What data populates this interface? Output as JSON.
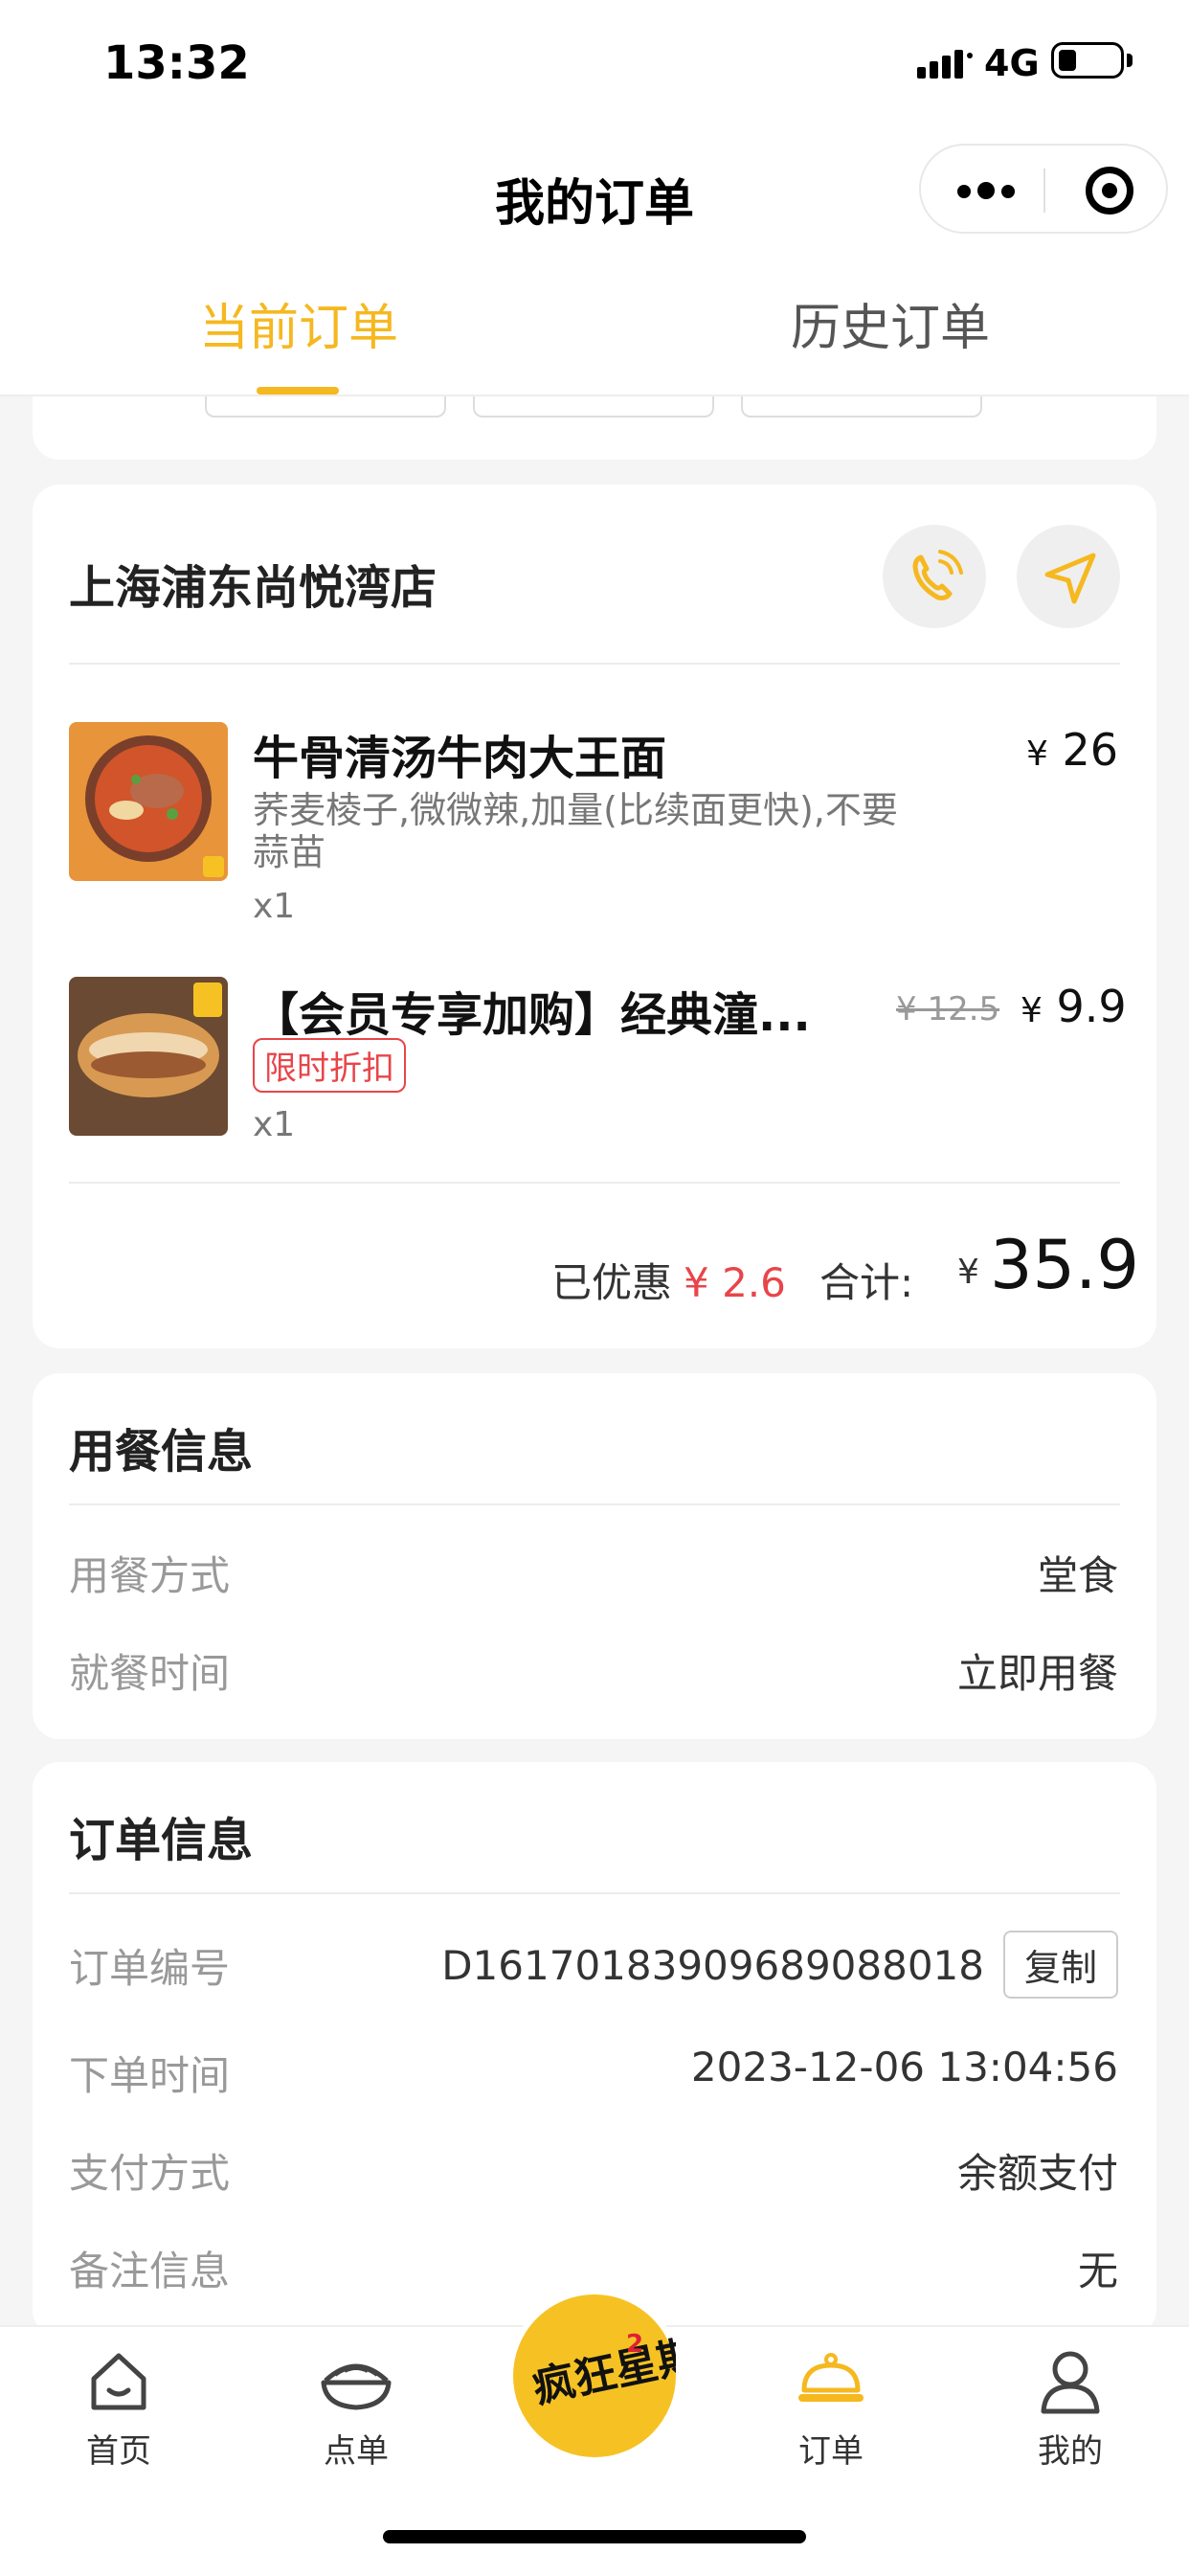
{
  "status_bar": {
    "time": "13:32",
    "network": "4G"
  },
  "nav": {
    "title": "我的订单"
  },
  "tabs": [
    {
      "label": "当前订单",
      "active": true
    },
    {
      "label": "历史订单",
      "active": false
    }
  ],
  "store": {
    "name": "上海浦东尚悦湾店",
    "items": [
      {
        "name": "牛骨清汤牛肉大王面",
        "spec_line1": "荞麦棱子,微微辣,加量(比续面更快),不要",
        "spec_line2": "蒜苗",
        "qty": "x1",
        "currency": "¥",
        "price": "26"
      },
      {
        "name": "【会员专享加购】经典潼...",
        "tag": "限时折扣",
        "qty": "x1",
        "currency": "¥",
        "original_price": "¥ 12.5",
        "price": "9.9"
      }
    ],
    "discount_label": "已优惠",
    "discount_value": "¥ 2.6",
    "total_label": "合计:",
    "total_currency": "¥",
    "total_value": "35.9"
  },
  "dining_info": {
    "title": "用餐信息",
    "rows": [
      {
        "label": "用餐方式",
        "value": "堂食"
      },
      {
        "label": "就餐时间",
        "value": "立即用餐"
      }
    ]
  },
  "order_info": {
    "title": "订单信息",
    "rows": [
      {
        "label": "订单编号",
        "value": "D16170183909689088018",
        "action": "复制"
      },
      {
        "label": "下单时间",
        "value": "2023-12-06 13:04:56"
      },
      {
        "label": "支付方式",
        "value": "余额支付"
      },
      {
        "label": "备注信息",
        "value": "无"
      }
    ]
  },
  "tabbar": {
    "items": [
      {
        "label": "首页",
        "icon": "home-icon"
      },
      {
        "label": "点单",
        "icon": "noodle-bowl-icon"
      },
      {
        "label": "订单",
        "icon": "cloche-icon",
        "active": true
      },
      {
        "label": "我的",
        "icon": "user-icon"
      }
    ],
    "center_logo_text": "疯狂星期"
  },
  "colors": {
    "accent": "#f5b81f",
    "discount_red": "#e8454a",
    "background": "#f5f5f5"
  }
}
